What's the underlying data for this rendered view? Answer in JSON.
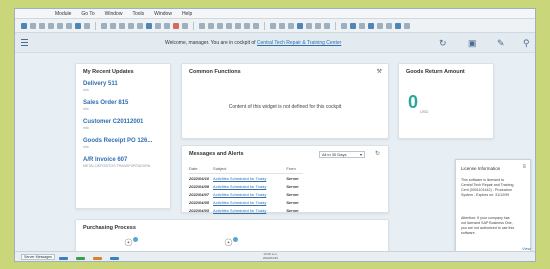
{
  "menu": [
    "Module",
    "Go To",
    "Window",
    "Tools",
    "Window",
    "Help"
  ],
  "header": {
    "welcome_prefix": "Welcome, manager. You are in cockpit of",
    "welcome_link": "Central Tech Repair & Training Center"
  },
  "recent_updates": {
    "title": "My Recent Updates",
    "items": [
      {
        "label": "Delivery 511",
        "sub": "info"
      },
      {
        "label": "Sales Order 815",
        "sub": "info"
      },
      {
        "label": "Customer C20112001",
        "sub": "info"
      },
      {
        "label": "Goods Receipt PO 126...",
        "sub": "info"
      },
      {
        "label": "A/R Invoice 607",
        "sub": "METAL DEPOSITOS TRANSPORTADORA"
      }
    ]
  },
  "common_functions": {
    "title": "Common Functions",
    "message": "Content of this widget is not defined for this cockpit"
  },
  "goods_return": {
    "title": "Goods Return Amount",
    "value": "0",
    "unit": "USD"
  },
  "messages": {
    "title": "Messages and Alerts",
    "filter": "All in 30 Days",
    "columns": [
      "Date",
      "Subject",
      "From"
    ],
    "rows": [
      {
        "date": "2022/04/10",
        "subject": "Activities Scheduled for Today",
        "from": "Server"
      },
      {
        "date": "2022/04/09",
        "subject": "Activities Scheduled for Today",
        "from": "Server"
      },
      {
        "date": "2022/04/07",
        "subject": "Activities Scheduled for Today",
        "from": "Server"
      },
      {
        "date": "2022/04/05",
        "subject": "Activities Scheduled for Today",
        "from": "Server"
      },
      {
        "date": "2022/04/03",
        "subject": "Activities Scheduled for Today",
        "from": "Server"
      }
    ]
  },
  "purchasing": {
    "title": "Purchasing Process"
  },
  "license": {
    "title": "License Information",
    "text1": "This software is licensed to Central Tech Repair and Training Cent (0001101442) - Production System - Expires on: 31/12/99",
    "text2": "Attention: If your company has not licensed SAP Business One, you are not authorized to use this software.",
    "view": "View"
  },
  "status": {
    "message_field": "Server Messages",
    "center_line1": "10:00 a.m.",
    "center_line2": "2022/04/10"
  },
  "colors": {
    "accent": "#2f6fb0",
    "kpi": "#2aa79b",
    "background": "#c9d77a"
  },
  "icons": [
    "menu-icon",
    "refresh-icon",
    "cockpit-icon",
    "edit-icon",
    "search-icon",
    "wrench-icon",
    "dropdown-icon",
    "close-icon"
  ]
}
